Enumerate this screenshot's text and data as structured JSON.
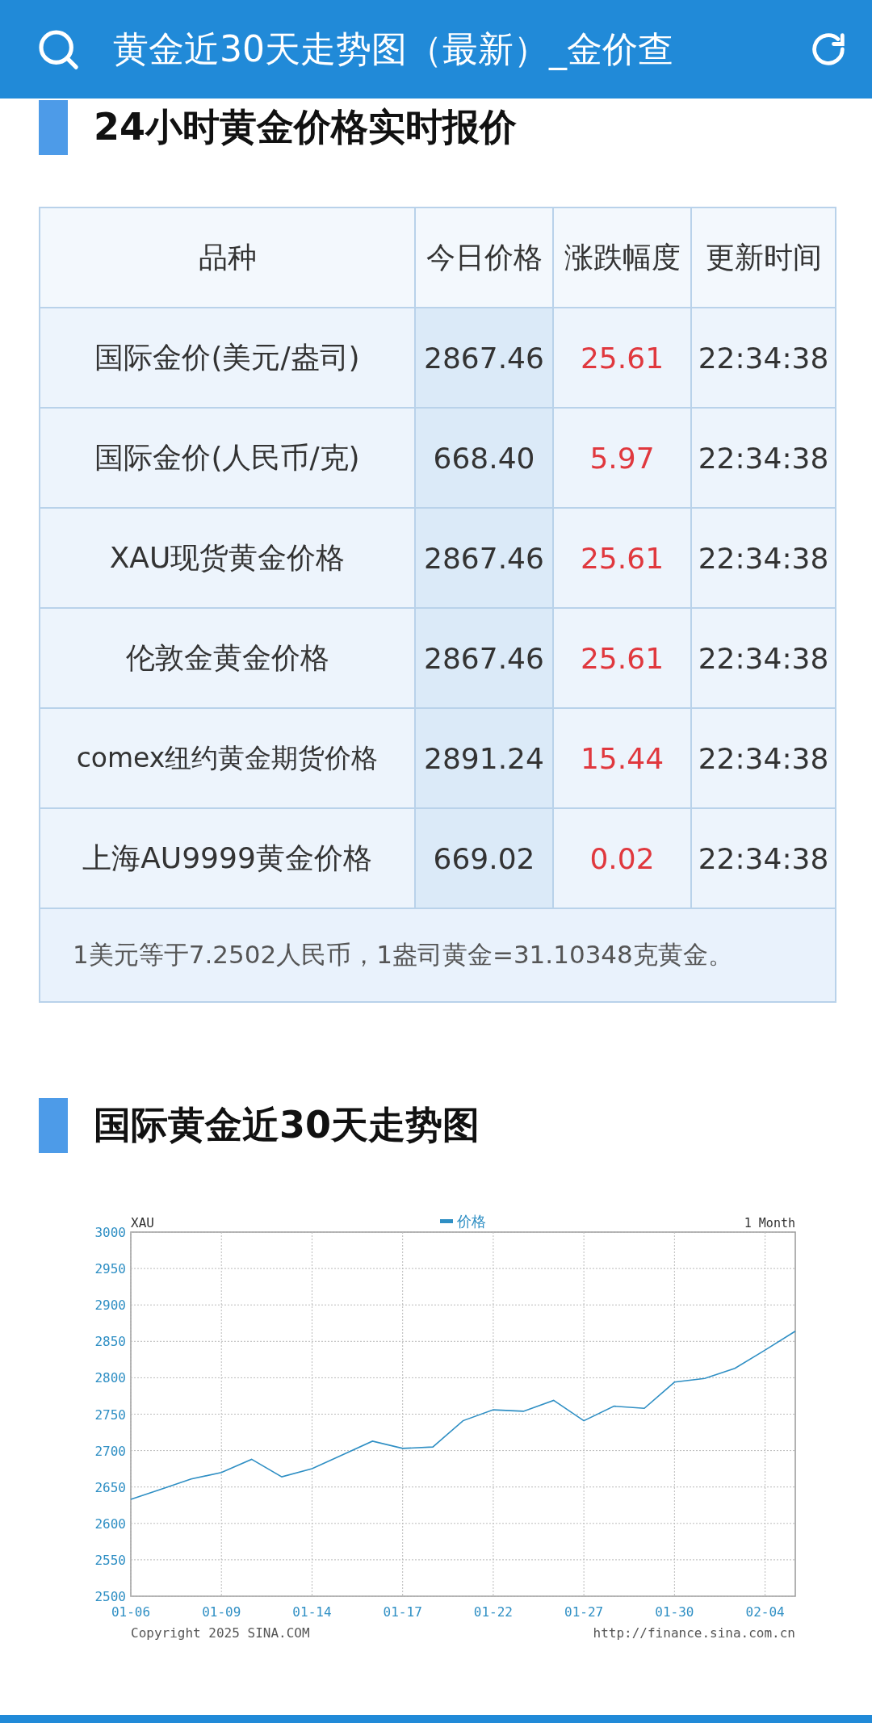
{
  "top_bar": {
    "title": "黄金近30天走势图（最新）_金价查"
  },
  "sections": [
    {
      "heading": "24小时黄金价格实时报价"
    },
    {
      "heading": "国际黄金近30天走势图"
    }
  ],
  "table": {
    "columns": [
      "品种",
      "今日价格",
      "涨跌幅度",
      "更新时间"
    ],
    "rows": [
      {
        "name": "国际金价(美元/盎司)",
        "price": "2867.46",
        "change": "25.61",
        "time": "22:34:38"
      },
      {
        "name": "国际金价(人民币/克)",
        "price": "668.40",
        "change": "5.97",
        "time": "22:34:38"
      },
      {
        "name": "XAU现货黄金价格",
        "price": "2867.46",
        "change": "25.61",
        "time": "22:34:38"
      },
      {
        "name": "伦敦金黄金价格",
        "price": "2867.46",
        "change": "25.61",
        "time": "22:34:38"
      },
      {
        "name": "comex纽约黄金期货价格",
        "price": "2891.24",
        "change": "15.44",
        "time": "22:34:38"
      },
      {
        "name": "上海AU9999黄金价格",
        "price": "669.02",
        "change": "0.02",
        "time": "22:34:38"
      }
    ],
    "note": "1美元等于7.2502人民币，1盎司黄金=31.10348克黄金。"
  },
  "chart": {
    "symbol": "XAU",
    "period": "1 Month",
    "copyright": "Copyright 2025 SINA.COM",
    "url": "http://finance.sina.com.cn",
    "chart_data": {
      "type": "line",
      "grid": true,
      "ylim": [
        2500,
        3000
      ],
      "categories": [
        "01-06",
        null,
        null,
        "01-09",
        null,
        null,
        "01-14",
        null,
        null,
        "01-17",
        null,
        null,
        "01-22",
        null,
        null,
        "01-27",
        null,
        null,
        "01-30",
        null,
        null,
        "02-04",
        null
      ],
      "yticks": [
        2500,
        2550,
        2600,
        2650,
        2700,
        2750,
        2800,
        2850,
        2900,
        2950,
        3000
      ],
      "series": [
        {
          "name": "价格",
          "color": "#2f8fc4",
          "values": [
            2633,
            2647,
            2661,
            2670,
            2688,
            2664,
            2675,
            2694,
            2713,
            2703,
            2705,
            2741,
            2756,
            2754,
            2769,
            2741,
            2761,
            2758,
            2794,
            2799,
            2813,
            2838,
            2864
          ]
        }
      ]
    }
  }
}
